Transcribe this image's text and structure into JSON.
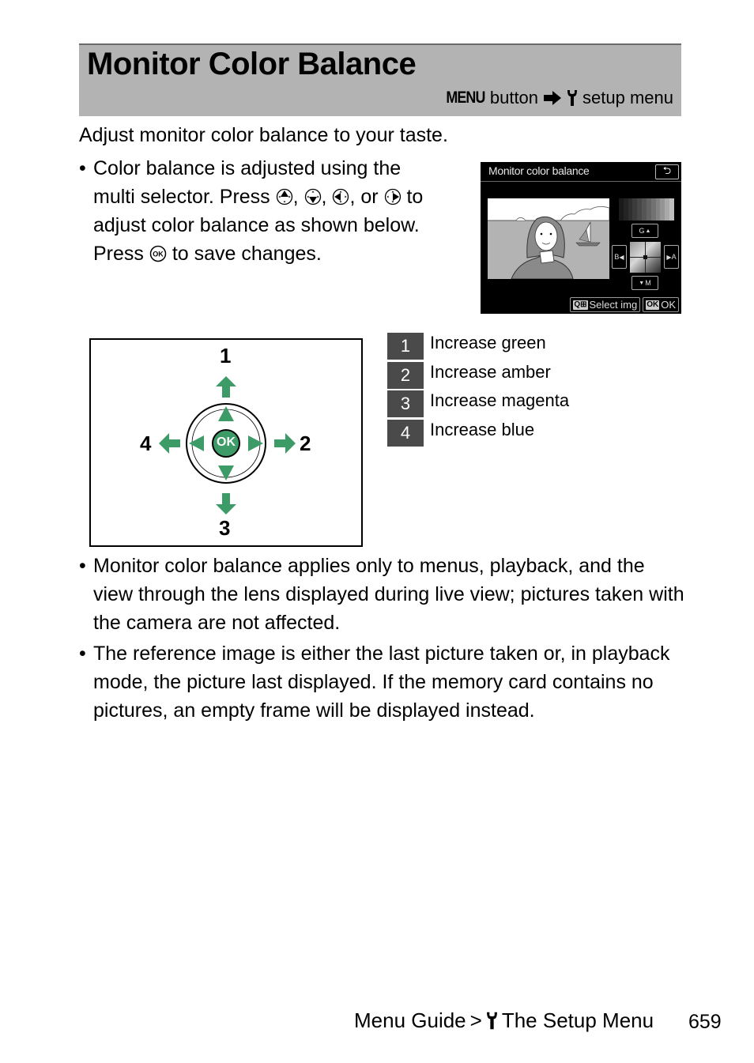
{
  "header": {
    "title": "Monitor Color Balance",
    "menu_word": "MENU",
    "path_button": "button",
    "path_menu": "setup menu"
  },
  "intro": "Adjust monitor color balance to your taste.",
  "instructions": {
    "bullet": "•",
    "lines": [
      "Color balance is adjusted using the",
      "multi selector. Press",
      ", or",
      "to",
      "adjust color balance as shown below.",
      "Press",
      "to save changes."
    ],
    "separators": [
      ",",
      ","
    ]
  },
  "camera_screen": {
    "title": "Monitor color balance",
    "back_symbol": "⮌",
    "labels": {
      "green": "G",
      "amber": "A",
      "magenta": "M",
      "blue": "B"
    },
    "footer_select": "Select img",
    "footer_ok_key": "OK",
    "footer_ok": "OK",
    "select_key": "Q⊞",
    "grayscale_steps": [
      "#1a1a1a",
      "#242424",
      "#2f2f2f",
      "#3b3b3b",
      "#474747",
      "#555555",
      "#636363",
      "#727272",
      "#838383",
      "#959595",
      "#a9a9a9",
      "#bfbfbf"
    ]
  },
  "diagram": {
    "numbers": [
      "1",
      "2",
      "3",
      "4"
    ],
    "ok_label": "OK",
    "accent_color": "#3d9b67"
  },
  "legend": [
    {
      "num": "1",
      "label": "Increase green"
    },
    {
      "num": "2",
      "label": "Increase amber"
    },
    {
      "num": "3",
      "label": "Increase magenta"
    },
    {
      "num": "4",
      "label": "Increase blue"
    }
  ],
  "notes": [
    "Monitor color balance applies only to menus, playback, and the view through the lens displayed during live view; pictures taken with the camera are not affected.",
    "The reference image is either the last picture taken or, in playback mode, the picture last displayed. If the memory card contains no pictures, an empty frame will be displayed instead."
  ],
  "footer": {
    "crumb_1": "Menu Guide",
    "separator": ">",
    "crumb_2": "The Setup Menu",
    "page_number": "659"
  }
}
